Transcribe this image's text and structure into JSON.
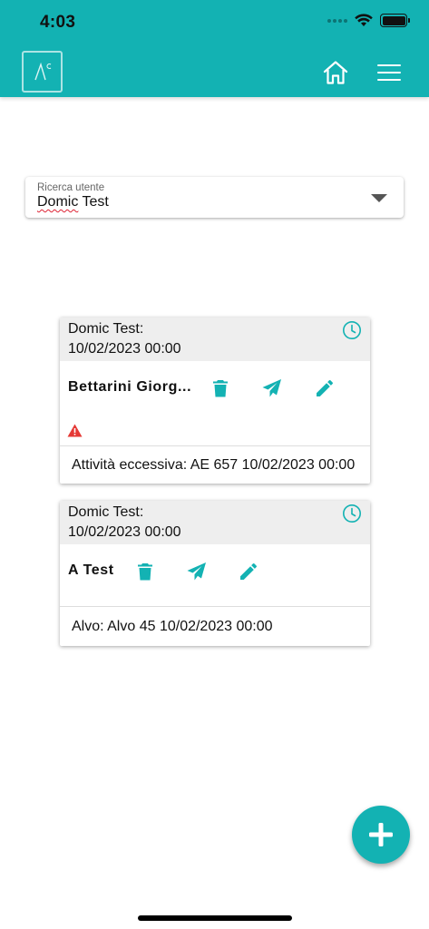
{
  "status_bar": {
    "time": "4:03"
  },
  "search": {
    "label": "Ricerca utente",
    "value_word1": "Domic",
    "value_word2": " Test"
  },
  "cards": [
    {
      "header_line1": "Domic Test:",
      "header_line2": "10/02/2023 00:00",
      "name": "Bettarini Giorg...",
      "warning": true,
      "footer": "Attività eccessiva: AE 657  10/02/2023 00:00"
    },
    {
      "header_line1": "Domic Test:",
      "header_line2": "10/02/2023 00:00",
      "name": "A Test",
      "warning": false,
      "footer": "Alvo: Alvo 45  10/02/2023 00:00"
    }
  ],
  "colors": {
    "accent": "#13b2b3",
    "warning": "#e53935",
    "card_header_bg": "#eeeeee"
  },
  "icons": [
    "logo-icon",
    "home-icon",
    "menu-icon",
    "dropdown-arrow-icon",
    "clock-icon",
    "trash-icon",
    "send-icon",
    "edit-icon",
    "warning-icon",
    "plus-icon"
  ]
}
